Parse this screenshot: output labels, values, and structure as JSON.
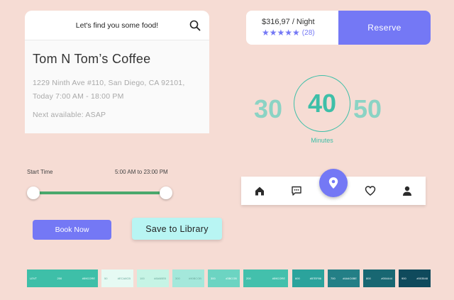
{
  "food": {
    "header": "Let's find you some food!",
    "name": "Tom N Tom’s Coffee",
    "address": "1229 Ninth Ave #110, San Diego, CA 92101,",
    "hours": "Today 7:00 AM - 18:00 PM",
    "next": "Next available: ASAP",
    "icons": {
      "search": "search-icon"
    }
  },
  "reservation": {
    "price": "$316,97 / Night",
    "rating": 5,
    "stars": "★★★★★",
    "reviews": "(28)",
    "button": "Reserve"
  },
  "timepicker": {
    "values": [
      "30",
      "40",
      "50"
    ],
    "selected": "40",
    "label": "Minutes"
  },
  "slider": {
    "label": "Start Time",
    "range_text": "5:00 AM to 23:00 PM",
    "start_fraction": 0,
    "end_fraction": 1
  },
  "nav": {
    "items": [
      "home-icon",
      "chat-icon",
      "location-pin-icon",
      "heart-icon",
      "user-icon"
    ],
    "active": "location-pin-icon"
  },
  "buttons": {
    "book": "Book Now",
    "save": "Save to Library"
  },
  "swatches": [
    {
      "color": "#3ebfa8",
      "left": "LEVT",
      "mid": "200",
      "right": "#59CORE"
    },
    {
      "color": "#e6faf3",
      "left": "50",
      "mid": "",
      "right": "#ECA8CB"
    },
    {
      "color": "#c6f4e5",
      "left": "100",
      "mid": "",
      "right": "#8A88EB"
    },
    {
      "color": "#a4e8db",
      "left": "300",
      "mid": "",
      "right": "#90BCOB"
    },
    {
      "color": "#6cd4c2",
      "left": "300",
      "mid": "",
      "right": "#3BCOB"
    },
    {
      "color": "#43c0ac",
      "left": "200",
      "mid": "",
      "right": "#59CORE"
    },
    {
      "color": "#2ba39c",
      "left": "600",
      "mid": "",
      "right": "#57EF86"
    },
    {
      "color": "#237f86",
      "left": "700",
      "mid": "",
      "right": "#4A4C6BE"
    },
    {
      "color": "#186772",
      "left": "800",
      "mid": "",
      "right": "#004444"
    },
    {
      "color": "#0f4a5c",
      "left": "900",
      "mid": "",
      "right": "#003548"
    }
  ]
}
